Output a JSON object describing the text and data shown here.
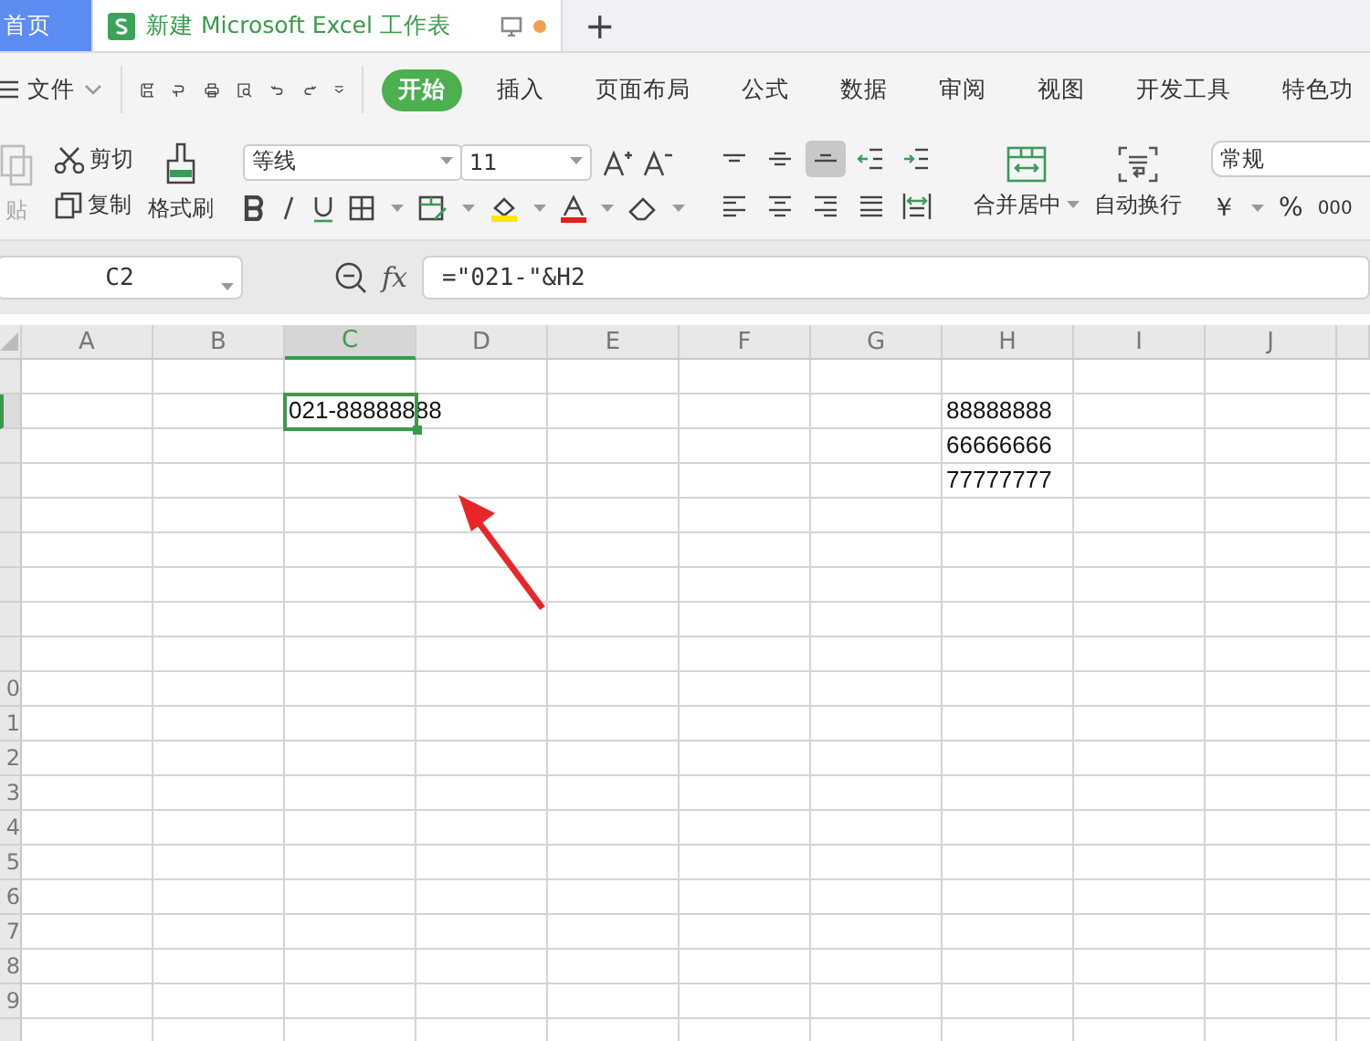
{
  "tabs": [
    {
      "label": "首页",
      "selected": false,
      "kind": "home"
    },
    {
      "label": "新建 Microsoft Excel 工作表",
      "selected": true,
      "kind": "doc"
    }
  ],
  "new_tab": "+",
  "menu": {
    "file": "文件",
    "tabs": [
      {
        "label": "开始",
        "selected": true
      },
      {
        "label": "插入",
        "selected": false
      },
      {
        "label": "页面布局",
        "selected": false
      },
      {
        "label": "公式",
        "selected": false
      },
      {
        "label": "数据",
        "selected": false
      },
      {
        "label": "审阅",
        "selected": false
      },
      {
        "label": "视图",
        "selected": false
      },
      {
        "label": "开发工具",
        "selected": false
      },
      {
        "label": "特色功",
        "selected": false
      }
    ]
  },
  "ribbon": {
    "paste": {
      "label": "贴",
      "disabled": true
    },
    "cut": "剪切",
    "copy": "复制",
    "format_painter": "格式刷",
    "font": "等线",
    "size": "11",
    "alignment": [
      {
        "kind": "top",
        "selected": false
      },
      {
        "kind": "middle",
        "selected": false
      },
      {
        "kind": "bottom",
        "selected": true
      },
      {
        "kind": "outdent",
        "selected": false
      },
      {
        "kind": "indent",
        "selected": false
      },
      {
        "kind": "left",
        "selected": false
      },
      {
        "kind": "center",
        "selected": false
      },
      {
        "kind": "right",
        "selected": false
      },
      {
        "kind": "justify",
        "selected": false
      },
      {
        "kind": "distributed",
        "selected": false
      }
    ],
    "merge": "合并居中",
    "wrap": "自动换行",
    "number_format": "常规",
    "currency": "￥",
    "percent": "%",
    "thousands": "000"
  },
  "formula_bar": {
    "name_box": "C2",
    "function_label": "fx",
    "formula": "=\"021-\"&H2"
  },
  "sheet": {
    "columns": [
      "A",
      "B",
      "C",
      "D",
      "E",
      "F",
      "G",
      "H",
      "I",
      "J"
    ],
    "rows": [
      {},
      {
        "cells": [
          null,
          null,
          {
            "text": "021-88888888",
            "selected": true
          },
          null,
          null,
          null,
          null,
          {
            "text": "88888888",
            "selected": false
          },
          null,
          null
        ]
      },
      {
        "cells": [
          null,
          null,
          null,
          null,
          null,
          null,
          null,
          {
            "text": "66666666",
            "selected": false
          },
          null,
          null
        ]
      },
      {
        "cells": [
          null,
          null,
          null,
          null,
          null,
          null,
          null,
          {
            "text": "77777777",
            "selected": false
          },
          null,
          null
        ]
      },
      {},
      {},
      {},
      {},
      {},
      {
        "header": "0"
      },
      {
        "header": "1"
      },
      {
        "header": "2"
      },
      {
        "header": "3"
      },
      {
        "header": "4"
      },
      {
        "header": "5"
      },
      {
        "header": "6"
      },
      {
        "header": "7"
      },
      {
        "header": "8"
      },
      {
        "header": "9"
      },
      {}
    ]
  }
}
